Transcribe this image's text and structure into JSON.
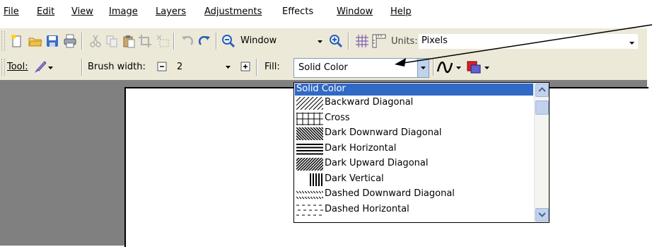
{
  "menu": {
    "items": [
      {
        "label": "File"
      },
      {
        "label": "Edit"
      },
      {
        "label": "View"
      },
      {
        "label": "Image"
      },
      {
        "label": "Layers"
      },
      {
        "label": "Adjustments"
      },
      {
        "label": "Effects"
      },
      {
        "label": "Window"
      },
      {
        "label": "Help"
      }
    ]
  },
  "toolbar1": {
    "icons": [
      "new-icon",
      "open-icon",
      "save-icon",
      "print-icon",
      "cut-icon",
      "copy-icon",
      "paste-icon",
      "crop-icon",
      "deselect-icon",
      "undo-icon",
      "redo-icon",
      "zoom-out-icon",
      "zoom-in-icon",
      "grid-icon",
      "rulers-icon"
    ],
    "zoom_value": "Window",
    "units_label": "Units:",
    "units_value": "Pixels"
  },
  "toolbar2": {
    "tool_label": "Tool:",
    "brush_width_label": "Brush width:",
    "brush_width_value": "2",
    "fill_label": "Fill:",
    "fill_value": "Solid Color"
  },
  "fill_dropdown": {
    "options": [
      {
        "label": "Solid Color",
        "pattern": "solid",
        "selected": true
      },
      {
        "label": "Backward Diagonal",
        "pattern": "backward-diagonal"
      },
      {
        "label": "Cross",
        "pattern": "cross"
      },
      {
        "label": "Dark Downward Diagonal",
        "pattern": "dark-downward-diagonal"
      },
      {
        "label": "Dark Horizontal",
        "pattern": "dark-horizontal"
      },
      {
        "label": "Dark Upward Diagonal",
        "pattern": "dark-upward-diagonal"
      },
      {
        "label": "Dark Vertical",
        "pattern": "dark-vertical"
      },
      {
        "label": "Dashed Downward Diagonal",
        "pattern": "dashed-downward-diagonal"
      },
      {
        "label": "Dashed Horizontal",
        "pattern": "dashed-horizontal"
      }
    ]
  },
  "colors": {
    "selection": "#316ac5",
    "toolbar": "#ece9d8",
    "workspace": "#808080"
  }
}
